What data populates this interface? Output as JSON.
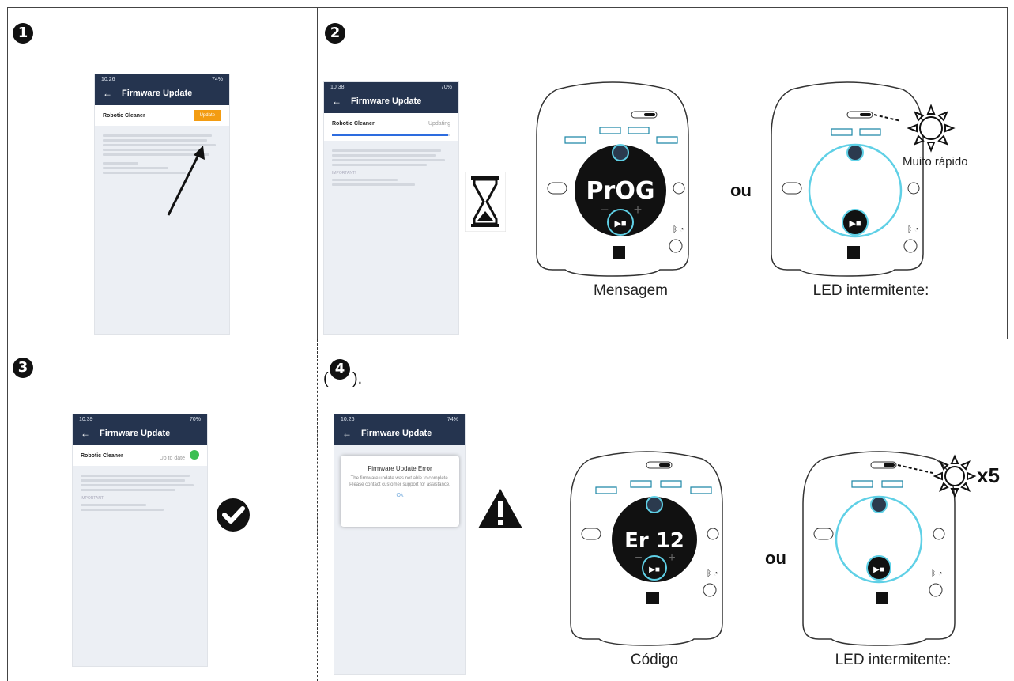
{
  "steps": {
    "s1": "1",
    "s2": "2",
    "s3": "3",
    "s4": "4",
    "paren_open": "(",
    "paren_close": ")."
  },
  "phone1": {
    "status_left": "10:26",
    "status_right": "74%",
    "back": "←",
    "title": "Firmware Update",
    "item": "Robotic Cleaner",
    "button": "Update"
  },
  "phone2": {
    "status_left": "10:38",
    "status_right": "70%",
    "back": "←",
    "title": "Firmware Update",
    "item": "Robotic Cleaner",
    "status": "Updating",
    "important": "IMPORTANT!"
  },
  "phone3": {
    "status_left": "10:39",
    "status_right": "70%",
    "back": "←",
    "title": "Firmware Update",
    "item": "Robotic Cleaner",
    "status": "Up to date",
    "important": "IMPORTANT!"
  },
  "phone4": {
    "status_left": "10:26",
    "status_right": "74%",
    "back": "←",
    "title": "Firmware Update",
    "dialog_title": "Firmware Update Error",
    "dialog_msg": "The firmware update was not able to complete. Please contact customer support for assistance.",
    "dialog_ok": "Ok"
  },
  "panel_top_left": {
    "display": "PrOG",
    "caption": "Mensagem"
  },
  "panel_top_right": {
    "caption": "LED intermitente:",
    "note": "Muito rápido"
  },
  "panel_bottom_left": {
    "display": "Er 12",
    "caption": "Código"
  },
  "panel_bottom_right": {
    "caption": "LED intermitente:",
    "count": "x5"
  },
  "or_word": "ou",
  "colors": {
    "navy": "#25344f",
    "orange": "#f39c12",
    "cyan": "#5fd0e6",
    "green": "#3cbf52"
  }
}
